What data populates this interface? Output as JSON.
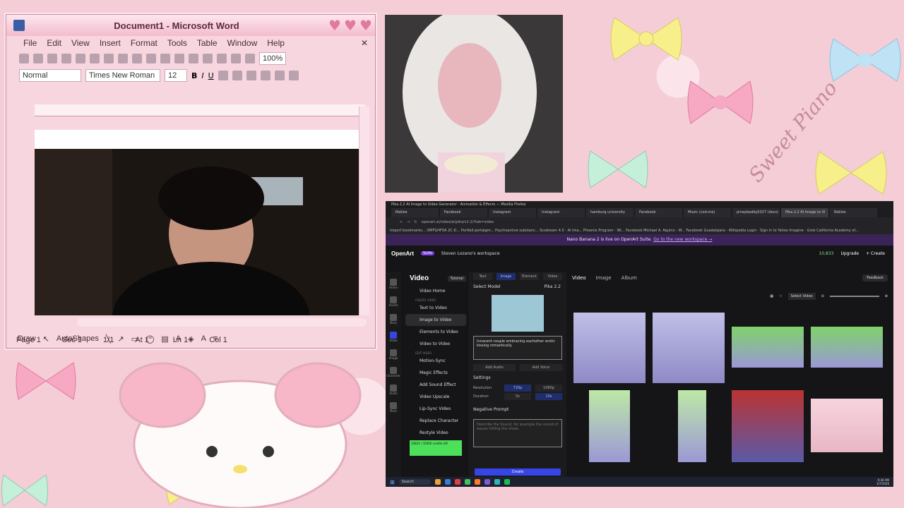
{
  "word": {
    "title": "Document1 - Microsoft Word",
    "menu": [
      "File",
      "Edit",
      "View",
      "Insert",
      "Format",
      "Tools",
      "Table",
      "Window",
      "Help"
    ],
    "style_combo": "Normal",
    "font_combo": "Times New Roman",
    "size_combo": "12",
    "zoom_combo": "100%",
    "draw_label": "Draw",
    "autoshapes_label": "AutoShapes",
    "status": {
      "page": "Page 1",
      "sec": "Sec 1",
      "pages": "1/1",
      "at": "At 1\"",
      "ln": "Ln 1",
      "col": "Col 1"
    },
    "bold": "B",
    "italic": "I",
    "underline": "U"
  },
  "browser": {
    "window_title": "Pika 2.2 AI Image to Video Generator - Animation & Effects — Mozilla Firefox",
    "tabs": [
      "Roblox",
      "Facebook",
      "Instagram",
      "Instagram",
      "hamburg university",
      "Facebook",
      "Music (cod.ma)",
      "pinaybaddy0327 (docs)",
      "Pika 2.2 AI Image to Vi",
      "Roblox"
    ],
    "url": "openart.ai/video/ai/pika/v2-2/?tab=video",
    "bookmarks": "Import bookmarks...   OMFGHF0A 2C-D...   Portfall portalgm...   Psychoactive substanc...   Scodream 4.5 - AI Ima...   Phoenix Program - Wi...   Facebook   Michael A. Aquino - W...   Facebook   Guadalajara - Wikipedia   Login · Sign in to Yahoo   Imagine - Grok   California Academy of...",
    "banner": "Nano Banana 2 is live on OpenArt Suite.",
    "banner_link": "Go to the new workspace →",
    "logo": "OpenArt",
    "logo_badge": "Suite",
    "workspace": "Steven Lozano's workspace",
    "credits": "10,833",
    "upgrade": "Upgrade",
    "create": "+ Create",
    "leftnav": [
      "Home",
      "Assets",
      "Story",
      "Video",
      "Image",
      "Character",
      "Audio",
      "More"
    ],
    "sidebar_title": "Video",
    "tutorial": "Tutorial",
    "sidebar_items": [
      "Video Home",
      "Text to Video",
      "Image to Video",
      "Elements to Video",
      "Video to Video",
      "Motion-Sync",
      "Magic Effects",
      "Add Sound Effect",
      "Video Upscale",
      "Lip-Sync Video",
      "Replace Character",
      "Restyle Video"
    ],
    "create_video_section": "CREATE VIDEO",
    "edit_video_section": "EDIT VIDEO",
    "mode_tabs": [
      "Text",
      "Image",
      "Element",
      "Video"
    ],
    "select_model": "Select Model",
    "model": "Pika 2.2",
    "prompt_text": "Innocent couple embracing eachother erotic kissing romantically",
    "add_audio": "Add Audio",
    "add_voice": "Add Voice",
    "settings": "Settings",
    "resolution_label": "Resolution",
    "resolutions": [
      "720p",
      "1080p"
    ],
    "duration_label": "Duration",
    "durations": [
      "5s",
      "10s"
    ],
    "negative_prompt": "Negative Prompt",
    "negative_placeholder": "Describe the Sound, for example the sound of waves hitting the shore.",
    "credits_box": "10833 / 32000 credits left",
    "generate": "Create",
    "gallery_tabs": [
      "Video",
      "Image",
      "Album"
    ],
    "feedback": "Feedback",
    "select_video": "Select Video",
    "clock_time": "9:40 AM",
    "clock_date": "3/7/2026",
    "search": "Search"
  },
  "wallpaper_text": "Sweet Piano",
  "colors": {
    "wallpaper": "#f4cdd7",
    "word_chrome": "#f7d6e0",
    "accent": "#7b3fe4",
    "generate": "#3646e6"
  }
}
